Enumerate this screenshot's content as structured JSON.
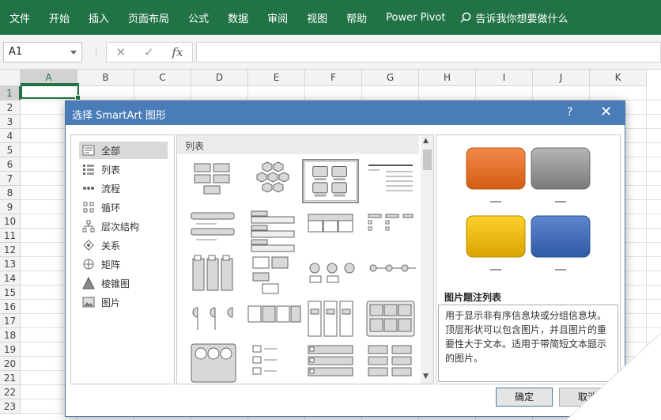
{
  "ribbon": {
    "tabs": [
      "文件",
      "开始",
      "插入",
      "页面布局",
      "公式",
      "数据",
      "审阅",
      "视图",
      "帮助",
      "Power Pivot"
    ],
    "tell_me": "告诉我你想要做什么"
  },
  "formula_bar": {
    "name_box": "A1",
    "fx": "fx",
    "cancel": "✕",
    "enter": "✓",
    "dots": "⋮"
  },
  "grid": {
    "columns": [
      "A",
      "B",
      "C",
      "D",
      "E",
      "F",
      "G",
      "H",
      "I",
      "J",
      "K"
    ],
    "rows": [
      "1",
      "2",
      "3",
      "4",
      "5",
      "6",
      "7",
      "8",
      "9",
      "10",
      "11",
      "12",
      "13",
      "14",
      "15",
      "16",
      "17",
      "18",
      "19",
      "20",
      "21",
      "22",
      "23"
    ]
  },
  "dialog": {
    "title": "选择 SmartArt 图形",
    "help": "?",
    "close": "✕",
    "categories": [
      {
        "label": "全部",
        "icon": "all-icon"
      },
      {
        "label": "列表",
        "icon": "list-icon"
      },
      {
        "label": "流程",
        "icon": "process-icon"
      },
      {
        "label": "循环",
        "icon": "cycle-icon"
      },
      {
        "label": "层次结构",
        "icon": "hierarchy-icon"
      },
      {
        "label": "关系",
        "icon": "relationship-icon"
      },
      {
        "label": "矩阵",
        "icon": "matrix-icon"
      },
      {
        "label": "棱锥图",
        "icon": "pyramid-icon"
      },
      {
        "label": "图片",
        "icon": "picture-icon"
      }
    ],
    "gallery_header": "列表",
    "preview_title": "图片题注列表",
    "preview_desc": "用于显示非有序信息块或分组信息块。顶层形状可以包含图片，并且图片的重要性大于文本。适用于带简短文本题示的图片。",
    "ok": "确定",
    "cancel": "取消",
    "colors": {
      "title_bar": "#4a7cb8",
      "orange": "#e46c1f",
      "gray": "#8c8c8c",
      "yellow": "#e8b800",
      "blue": "#3f6ab4"
    }
  }
}
